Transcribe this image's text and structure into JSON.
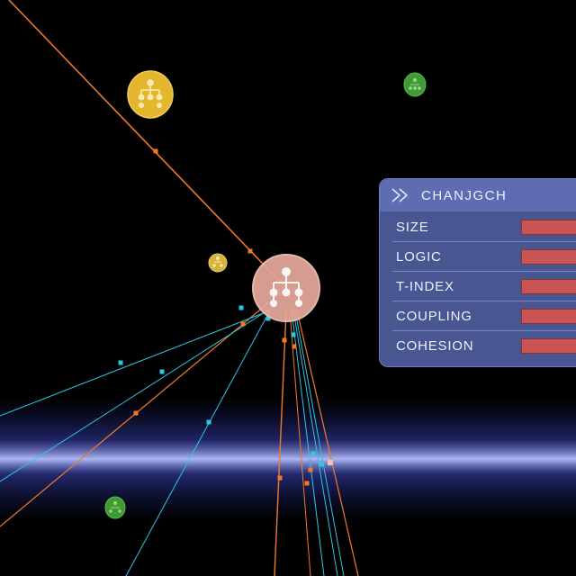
{
  "inspector": {
    "title": "CHANJGCH",
    "icon": "chevron-right-icon",
    "metrics": [
      {
        "label": "SIZE",
        "level": 1.0
      },
      {
        "label": "LOGIC",
        "level": 1.0
      },
      {
        "label": "T-INDEX",
        "level": 1.0
      },
      {
        "label": "COUPLING",
        "level": 1.0
      },
      {
        "label": "COHESION",
        "level": 1.0
      }
    ]
  },
  "scene": {
    "nodes": [
      {
        "kind": "selected",
        "icon": "hierarchy-icon",
        "color": "#e6a89a"
      },
      {
        "kind": "yellow",
        "icon": "hierarchy-icon",
        "color": "#e3b62e"
      },
      {
        "kind": "yellow-small",
        "icon": "hierarchy-icon",
        "color": "#d8b33a"
      },
      {
        "kind": "green",
        "icon": "hierarchy-icon",
        "color": "#3e9a32"
      },
      {
        "kind": "green",
        "icon": "hierarchy-icon",
        "color": "#3e9a32"
      }
    ],
    "link_colors": {
      "orange": "#f07a2a",
      "cyan": "#2ac8e6"
    },
    "band_color": "#6a78ff"
  }
}
